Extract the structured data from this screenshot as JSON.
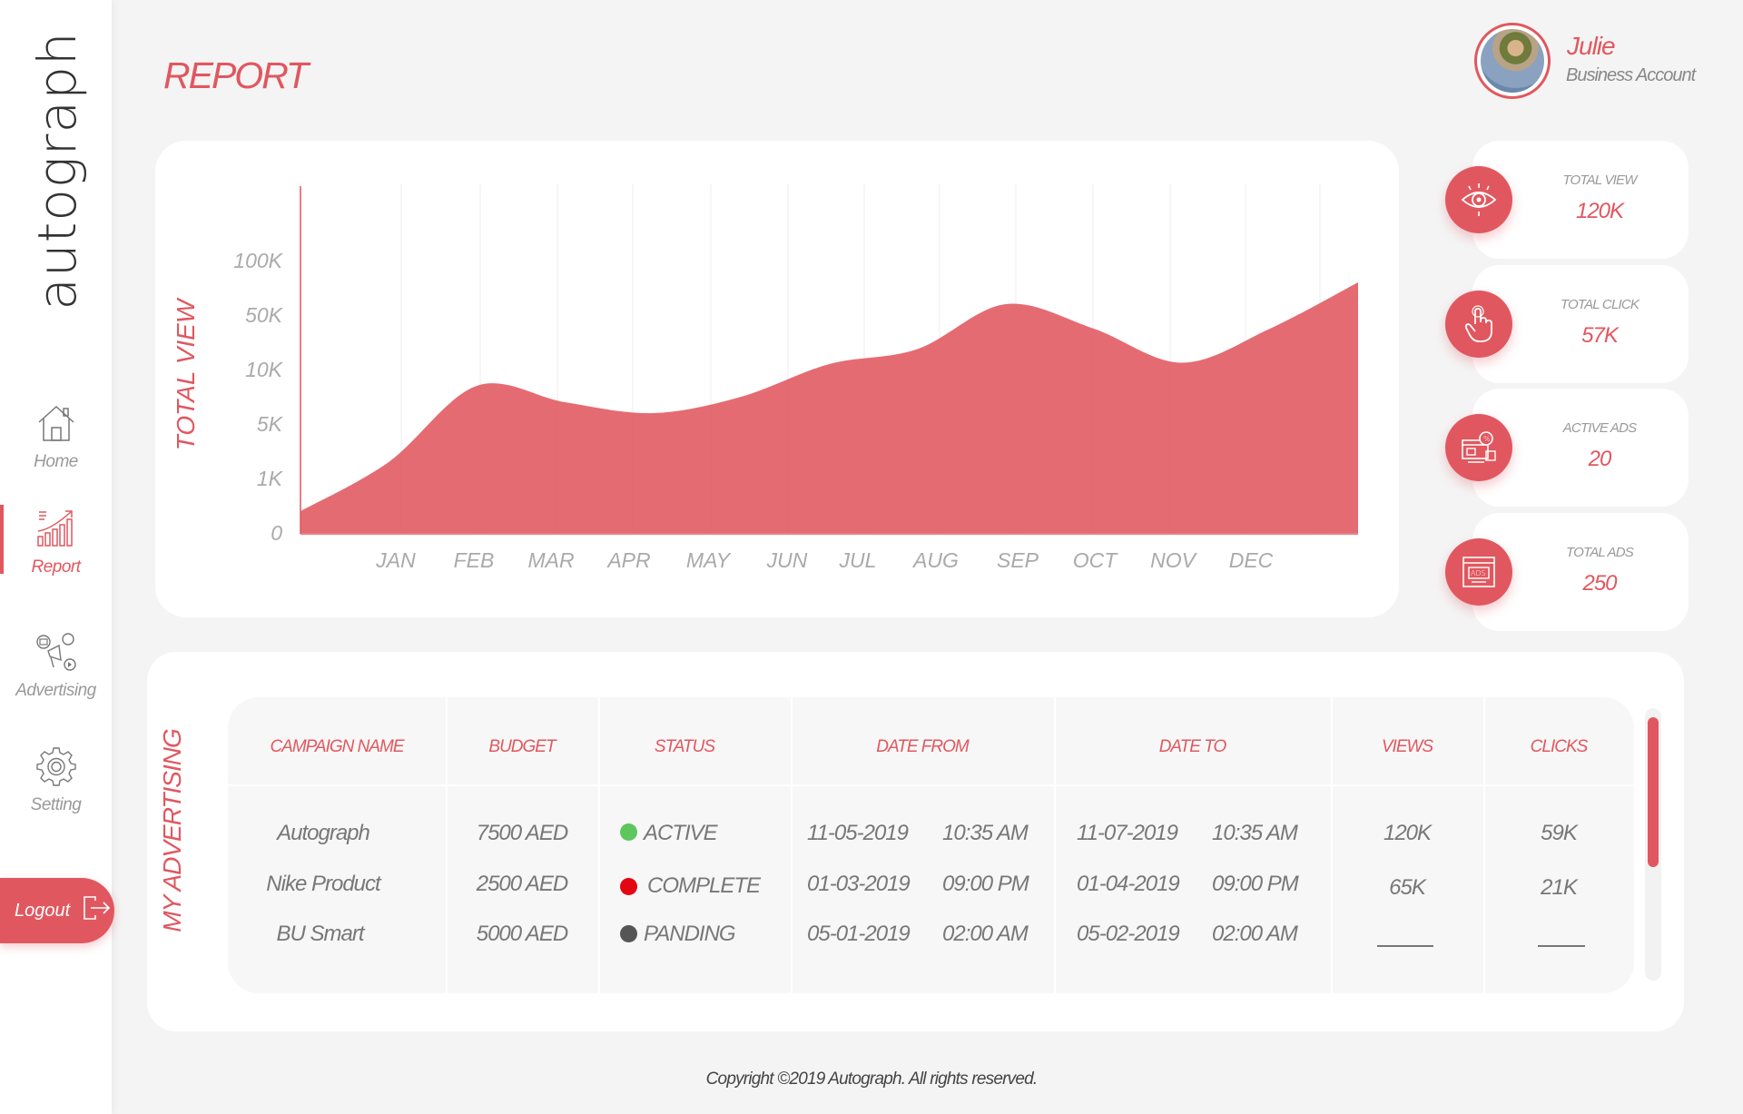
{
  "brand": {
    "logo_text": "autograph"
  },
  "sidebar": {
    "items": [
      {
        "label": "Home",
        "icon": "home-icon",
        "active": false
      },
      {
        "label": "Report",
        "icon": "report-icon",
        "active": true
      },
      {
        "label": "Advertising",
        "icon": "advertising-icon",
        "active": false
      },
      {
        "label": "Setting",
        "icon": "gear-icon",
        "active": false
      }
    ],
    "logout_label": "Logout"
  },
  "header": {
    "title": "REPORT"
  },
  "profile": {
    "name": "Julie",
    "role": "Business Account"
  },
  "colors": {
    "accent": "#e1575f",
    "active_dot": "#5dc65d",
    "complete_dot": "#e30613",
    "pending_dot": "#555555"
  },
  "chart_data": {
    "type": "area",
    "categories": [
      "JAN",
      "FEB",
      "MAR",
      "APR",
      "MAY",
      "JUN",
      "JUL",
      "AUG",
      "SEP",
      "OCT",
      "NOV",
      "DEC"
    ],
    "ylabel": "TOTAL VIEW",
    "y_ticks": [
      "0",
      "1K",
      "5K",
      "10K",
      "50K",
      "100K"
    ],
    "y_tick_values": [
      0,
      1000,
      5000,
      10000,
      50000,
      100000
    ],
    "series": [
      {
        "values": [
          400,
          2200,
          8500,
          7000,
          6000,
          7500,
          14000,
          25000,
          60000,
          40000,
          15000,
          40000,
          80000
        ]
      }
    ],
    "x_points": [
      "",
      "JAN",
      "FEB",
      "MAR",
      "APR",
      "MAY",
      "JUN",
      "JUL",
      "AUG",
      "SEP",
      "OCT",
      "NOV",
      "DEC"
    ],
    "grid": "vertical",
    "legend": "none"
  },
  "stats": [
    {
      "label": "TOTAL VIEW",
      "value": "120K",
      "icon": "eye-icon"
    },
    {
      "label": "TOTAL CLICK",
      "value": "57K",
      "icon": "click-icon"
    },
    {
      "label": "ACTIVE ADS",
      "value": "20",
      "icon": "active-ads-icon"
    },
    {
      "label": "TOTAL ADS",
      "value": "250",
      "icon": "ads-icon"
    }
  ],
  "table": {
    "section_label": "MY ADVERTISING",
    "headers": [
      "CAMPAIGN NAME",
      "BUDGET",
      "STATUS",
      "DATE FROM",
      "DATE TO",
      "VIEWS",
      "CLICKS"
    ],
    "rows": [
      {
        "name": "Autograph",
        "budget": "7500 AED",
        "status": "ACTIVE",
        "date_from": "11-05-2019",
        "time_from": "10:35 AM",
        "date_to": "11-07-2019",
        "time_to": "10:35 AM",
        "views": "120K",
        "clicks": "59K"
      },
      {
        "name": "Nike Product",
        "budget": "2500 AED",
        "status": "COMPLETE",
        "date_from": "01-03-2019",
        "time_from": "09:00 PM",
        "date_to": "01-04-2019",
        "time_to": "09:00 PM",
        "views": "65K",
        "clicks": "21K"
      },
      {
        "name": "BU Smart",
        "budget": "5000 AED",
        "status": "PANDING",
        "date_from": "05-01-2019",
        "time_from": "02:00 AM",
        "date_to": "05-02-2019",
        "time_to": "02:00 AM",
        "views": "",
        "clicks": ""
      }
    ]
  },
  "footer": {
    "copyright": "Copyright ©2019 Autograph. All rights reserved."
  }
}
